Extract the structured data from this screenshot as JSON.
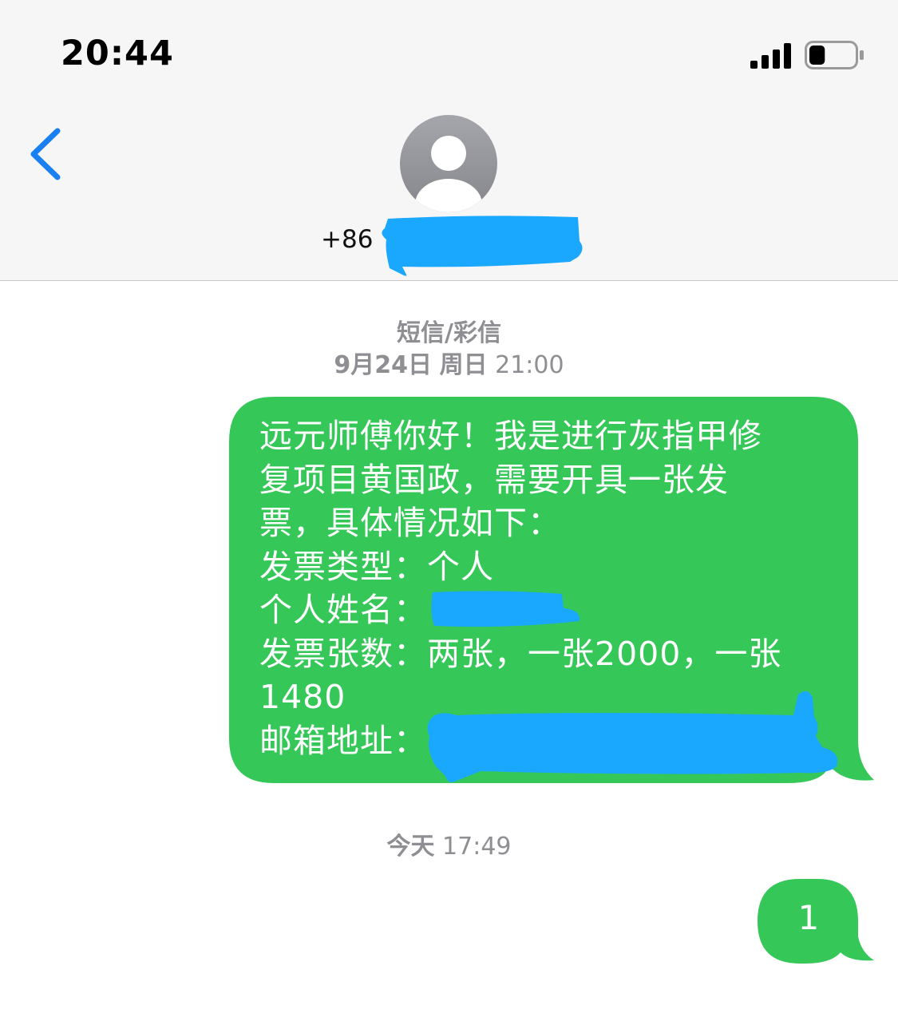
{
  "status_bar": {
    "time": "20:44",
    "signal_icon": "cellular-signal-icon",
    "battery_icon": "battery-icon",
    "battery_level": 0.35
  },
  "nav": {
    "back_icon": "chevron-left-icon",
    "avatar_icon": "person-avatar-icon",
    "contact_prefix": "+86",
    "accent_color": "#1a7ff0"
  },
  "conversation": {
    "service_label": "短信/彩信",
    "first_date": {
      "date": "9月24日",
      "weekday": "周日",
      "time": "21:00"
    },
    "messages": [
      {
        "lines": [
          "远元师傅你好！我是进行灰指甲修",
          "复项目黄国政，需要开具一张发",
          "票，具体情况如下：",
          "发票类型：个人",
          "个人姓名：",
          "发票张数：两张，一张2000，一张",
          "1480",
          "邮箱地址："
        ]
      }
    ],
    "second_date": {
      "date": "今天",
      "time": "17:49"
    },
    "reply": "1",
    "bubble_color": "#36c759",
    "redaction_color": "#1aa8ff"
  }
}
